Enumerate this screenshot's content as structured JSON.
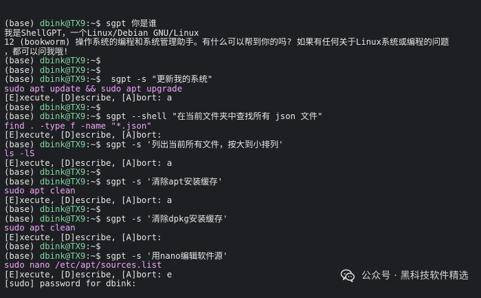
{
  "terminal": {
    "lines": [
      [
        {
          "t": "(base) ",
          "c": "default"
        },
        {
          "t": "dbink@TX9",
          "c": "user"
        },
        {
          "t": ":~$ sgpt 你是谁",
          "c": "default"
        }
      ],
      [
        {
          "t": "我是ShellGPT，一个Linux/Debian GNU/Linux",
          "c": "default"
        }
      ],
      [
        {
          "t": "12 (bookworm) 操作系统的编程和系统管理助手。有什么可以帮到你的吗? 如果有任何关于Linux系统或编程的问题",
          "c": "default"
        }
      ],
      [
        {
          "t": "，都可以问我哦!",
          "c": "default"
        }
      ],
      [
        {
          "t": "(base) ",
          "c": "default"
        },
        {
          "t": "dbink@TX9",
          "c": "user"
        },
        {
          "t": ":~$",
          "c": "default"
        }
      ],
      [
        {
          "t": "(base) ",
          "c": "default"
        },
        {
          "t": "dbink@TX9",
          "c": "user"
        },
        {
          "t": ":~$",
          "c": "default"
        }
      ],
      [
        {
          "t": "(base) ",
          "c": "default"
        },
        {
          "t": "dbink@TX9",
          "c": "user"
        },
        {
          "t": ":~$  sgpt -s \"更新我的系统\"",
          "c": "default"
        }
      ],
      [
        {
          "t": "sudo apt update && sudo apt upgrade",
          "c": "command"
        }
      ],
      [
        {
          "t": "[E]xecute, [D]escribe, [A]bort: a",
          "c": "default"
        }
      ],
      [
        {
          "t": "(base) ",
          "c": "default"
        },
        {
          "t": "dbink@TX9",
          "c": "user"
        },
        {
          "t": ":~$",
          "c": "default"
        }
      ],
      [
        {
          "t": "(base) ",
          "c": "default"
        },
        {
          "t": "dbink@TX9",
          "c": "user"
        },
        {
          "t": ":~$ sgpt --shell \"在当前文件夹中查找所有 json 文件\"",
          "c": "default"
        }
      ],
      [
        {
          "t": "find . -type f -name \"*.json\"",
          "c": "command"
        }
      ],
      [
        {
          "t": "[E]xecute, [D]escribe, [A]bort:",
          "c": "default"
        }
      ],
      [
        {
          "t": "(base) ",
          "c": "default"
        },
        {
          "t": "dbink@TX9",
          "c": "user"
        },
        {
          "t": ":~$ sgpt -s '列出当前所有文件，按大到小排列'",
          "c": "default"
        }
      ],
      [
        {
          "t": "ls -lS",
          "c": "command"
        }
      ],
      [
        {
          "t": "[E]xecute, [D]escribe, [A]bort: a",
          "c": "default"
        }
      ],
      [
        {
          "t": "(base) ",
          "c": "default"
        },
        {
          "t": "dbink@TX9",
          "c": "user"
        },
        {
          "t": ":~$",
          "c": "default"
        }
      ],
      [
        {
          "t": "(base) ",
          "c": "default"
        },
        {
          "t": "dbink@TX9",
          "c": "user"
        },
        {
          "t": ":~$ sgpt -s '清除apt安装缓存'",
          "c": "default"
        }
      ],
      [
        {
          "t": "sudo apt clean",
          "c": "command"
        }
      ],
      [
        {
          "t": "[E]xecute, [D]escribe, [A]bort: a",
          "c": "default"
        }
      ],
      [
        {
          "t": "(base) ",
          "c": "default"
        },
        {
          "t": "dbink@TX9",
          "c": "user"
        },
        {
          "t": ":~$",
          "c": "default"
        }
      ],
      [
        {
          "t": "(base) ",
          "c": "default"
        },
        {
          "t": "dbink@TX9",
          "c": "user"
        },
        {
          "t": ":~$ sgpt -s '清除dpkg安装缓存'",
          "c": "default"
        }
      ],
      [
        {
          "t": "sudo apt clean",
          "c": "command"
        }
      ],
      [
        {
          "t": "[E]xecute, [D]escribe, [A]bort:",
          "c": "default"
        }
      ],
      [
        {
          "t": "(base) ",
          "c": "default"
        },
        {
          "t": "dbink@TX9",
          "c": "user"
        },
        {
          "t": ":~$",
          "c": "default"
        }
      ],
      [
        {
          "t": "(base) ",
          "c": "default"
        },
        {
          "t": "dbink@TX9",
          "c": "user"
        },
        {
          "t": ":~$ sgpt -s '用nano编辑软件源'",
          "c": "default"
        }
      ],
      [
        {
          "t": "sudo nano /etc/apt/sources.list",
          "c": "command"
        }
      ],
      [
        {
          "t": "[E]xecute, [D]escribe, [A]bort: e",
          "c": "default"
        }
      ],
      [
        {
          "t": "[sudo] password for dbink:",
          "c": "default"
        }
      ]
    ]
  },
  "watermark": {
    "icon": "wechat-icon",
    "text": "公众号 · 黑科技软件精选"
  },
  "colors": {
    "background": "#1e1f22",
    "text": "#e6e6e6",
    "user": "#7fd6a3",
    "command": "#f0a6ff",
    "watermark": "#d5d5d5"
  }
}
